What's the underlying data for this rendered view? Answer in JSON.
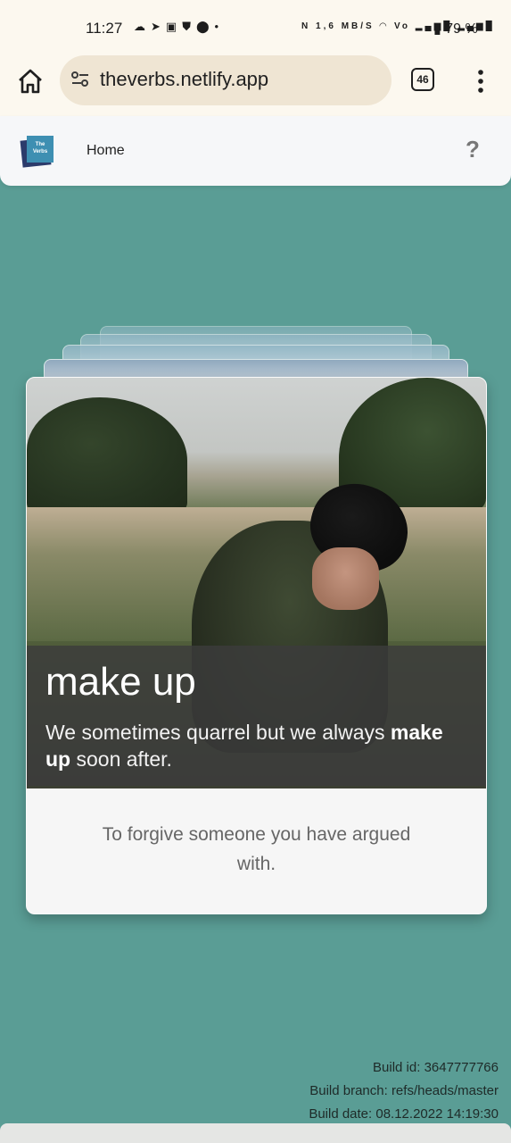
{
  "status_bar": {
    "time": "11:27",
    "left_icons": [
      "cloud-icon",
      "telegram-icon",
      "calendar-icon",
      "shield-icon",
      "location-icon",
      "dot-icon"
    ],
    "right_icons": [
      "nfc-icon",
      "data-speed-icon",
      "wifi-icon",
      "volte-icon",
      "signal-icon",
      "signal-icon",
      "battery-icon"
    ],
    "speed": "1,6 MB/S",
    "battery": "79 %"
  },
  "browser": {
    "url": "theverbs.netlify.app",
    "tabs_count": "46"
  },
  "app_header": {
    "logo_text_line1": "The",
    "logo_text_line2": "Verbs",
    "nav_home": "Home",
    "help": "?"
  },
  "card": {
    "verb": "make up",
    "example_prefix": "We sometimes quarrel but we always ",
    "example_highlight": "make up",
    "example_suffix": " soon after.",
    "definition_line1": "To forgive someone you have argued",
    "definition_line2": "with."
  },
  "build_info": {
    "id": "Build id: 3647777766",
    "branch": "Build branch: refs/heads/master",
    "date": "Build date: 08.12.2022 14:19:30"
  },
  "colors": {
    "background": "#5a9d95",
    "header": "#f6f7f9",
    "browser_bar": "#fcf8ef",
    "url_box": "#efe5d3"
  }
}
